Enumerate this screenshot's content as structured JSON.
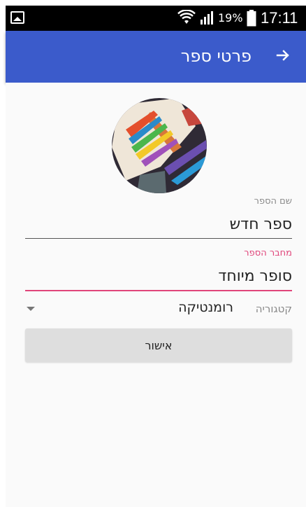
{
  "status_bar": {
    "battery_percent": "19%",
    "time": "17:11",
    "icons": [
      "image-icon",
      "wifi-icon",
      "signal-icon",
      "battery-icon"
    ]
  },
  "app_bar": {
    "title": "פרטי ספר",
    "back_icon": "arrow-right-icon",
    "color": "#3b5bcb"
  },
  "form": {
    "book_name": {
      "label": "שם הספר",
      "value": "ספר חדש"
    },
    "author": {
      "label": "מחבר הספר",
      "value": "סופר מיוחד"
    },
    "category": {
      "label": "קטגוריה",
      "value": "רומנטיקה"
    },
    "confirm_label": "אישור",
    "accent_color": "#e0457a"
  }
}
